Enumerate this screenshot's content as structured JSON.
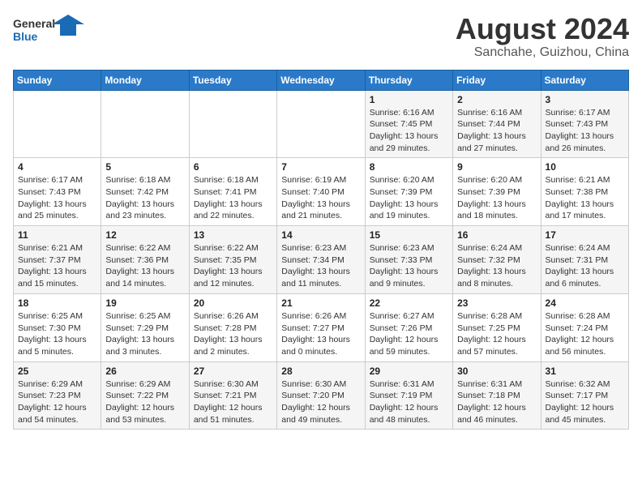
{
  "logo": {
    "line1": "General",
    "line2": "Blue"
  },
  "title": "August 2024",
  "subtitle": "Sanchahe, Guizhou, China",
  "days_header": [
    "Sunday",
    "Monday",
    "Tuesday",
    "Wednesday",
    "Thursday",
    "Friday",
    "Saturday"
  ],
  "weeks": [
    [
      {
        "day": "",
        "info": ""
      },
      {
        "day": "",
        "info": ""
      },
      {
        "day": "",
        "info": ""
      },
      {
        "day": "",
        "info": ""
      },
      {
        "day": "1",
        "info": "Sunrise: 6:16 AM\nSunset: 7:45 PM\nDaylight: 13 hours\nand 29 minutes."
      },
      {
        "day": "2",
        "info": "Sunrise: 6:16 AM\nSunset: 7:44 PM\nDaylight: 13 hours\nand 27 minutes."
      },
      {
        "day": "3",
        "info": "Sunrise: 6:17 AM\nSunset: 7:43 PM\nDaylight: 13 hours\nand 26 minutes."
      }
    ],
    [
      {
        "day": "4",
        "info": "Sunrise: 6:17 AM\nSunset: 7:43 PM\nDaylight: 13 hours\nand 25 minutes."
      },
      {
        "day": "5",
        "info": "Sunrise: 6:18 AM\nSunset: 7:42 PM\nDaylight: 13 hours\nand 23 minutes."
      },
      {
        "day": "6",
        "info": "Sunrise: 6:18 AM\nSunset: 7:41 PM\nDaylight: 13 hours\nand 22 minutes."
      },
      {
        "day": "7",
        "info": "Sunrise: 6:19 AM\nSunset: 7:40 PM\nDaylight: 13 hours\nand 21 minutes."
      },
      {
        "day": "8",
        "info": "Sunrise: 6:20 AM\nSunset: 7:39 PM\nDaylight: 13 hours\nand 19 minutes."
      },
      {
        "day": "9",
        "info": "Sunrise: 6:20 AM\nSunset: 7:39 PM\nDaylight: 13 hours\nand 18 minutes."
      },
      {
        "day": "10",
        "info": "Sunrise: 6:21 AM\nSunset: 7:38 PM\nDaylight: 13 hours\nand 17 minutes."
      }
    ],
    [
      {
        "day": "11",
        "info": "Sunrise: 6:21 AM\nSunset: 7:37 PM\nDaylight: 13 hours\nand 15 minutes."
      },
      {
        "day": "12",
        "info": "Sunrise: 6:22 AM\nSunset: 7:36 PM\nDaylight: 13 hours\nand 14 minutes."
      },
      {
        "day": "13",
        "info": "Sunrise: 6:22 AM\nSunset: 7:35 PM\nDaylight: 13 hours\nand 12 minutes."
      },
      {
        "day": "14",
        "info": "Sunrise: 6:23 AM\nSunset: 7:34 PM\nDaylight: 13 hours\nand 11 minutes."
      },
      {
        "day": "15",
        "info": "Sunrise: 6:23 AM\nSunset: 7:33 PM\nDaylight: 13 hours\nand 9 minutes."
      },
      {
        "day": "16",
        "info": "Sunrise: 6:24 AM\nSunset: 7:32 PM\nDaylight: 13 hours\nand 8 minutes."
      },
      {
        "day": "17",
        "info": "Sunrise: 6:24 AM\nSunset: 7:31 PM\nDaylight: 13 hours\nand 6 minutes."
      }
    ],
    [
      {
        "day": "18",
        "info": "Sunrise: 6:25 AM\nSunset: 7:30 PM\nDaylight: 13 hours\nand 5 minutes."
      },
      {
        "day": "19",
        "info": "Sunrise: 6:25 AM\nSunset: 7:29 PM\nDaylight: 13 hours\nand 3 minutes."
      },
      {
        "day": "20",
        "info": "Sunrise: 6:26 AM\nSunset: 7:28 PM\nDaylight: 13 hours\nand 2 minutes."
      },
      {
        "day": "21",
        "info": "Sunrise: 6:26 AM\nSunset: 7:27 PM\nDaylight: 13 hours\nand 0 minutes."
      },
      {
        "day": "22",
        "info": "Sunrise: 6:27 AM\nSunset: 7:26 PM\nDaylight: 12 hours\nand 59 minutes."
      },
      {
        "day": "23",
        "info": "Sunrise: 6:28 AM\nSunset: 7:25 PM\nDaylight: 12 hours\nand 57 minutes."
      },
      {
        "day": "24",
        "info": "Sunrise: 6:28 AM\nSunset: 7:24 PM\nDaylight: 12 hours\nand 56 minutes."
      }
    ],
    [
      {
        "day": "25",
        "info": "Sunrise: 6:29 AM\nSunset: 7:23 PM\nDaylight: 12 hours\nand 54 minutes."
      },
      {
        "day": "26",
        "info": "Sunrise: 6:29 AM\nSunset: 7:22 PM\nDaylight: 12 hours\nand 53 minutes."
      },
      {
        "day": "27",
        "info": "Sunrise: 6:30 AM\nSunset: 7:21 PM\nDaylight: 12 hours\nand 51 minutes."
      },
      {
        "day": "28",
        "info": "Sunrise: 6:30 AM\nSunset: 7:20 PM\nDaylight: 12 hours\nand 49 minutes."
      },
      {
        "day": "29",
        "info": "Sunrise: 6:31 AM\nSunset: 7:19 PM\nDaylight: 12 hours\nand 48 minutes."
      },
      {
        "day": "30",
        "info": "Sunrise: 6:31 AM\nSunset: 7:18 PM\nDaylight: 12 hours\nand 46 minutes."
      },
      {
        "day": "31",
        "info": "Sunrise: 6:32 AM\nSunset: 7:17 PM\nDaylight: 12 hours\nand 45 minutes."
      }
    ]
  ]
}
